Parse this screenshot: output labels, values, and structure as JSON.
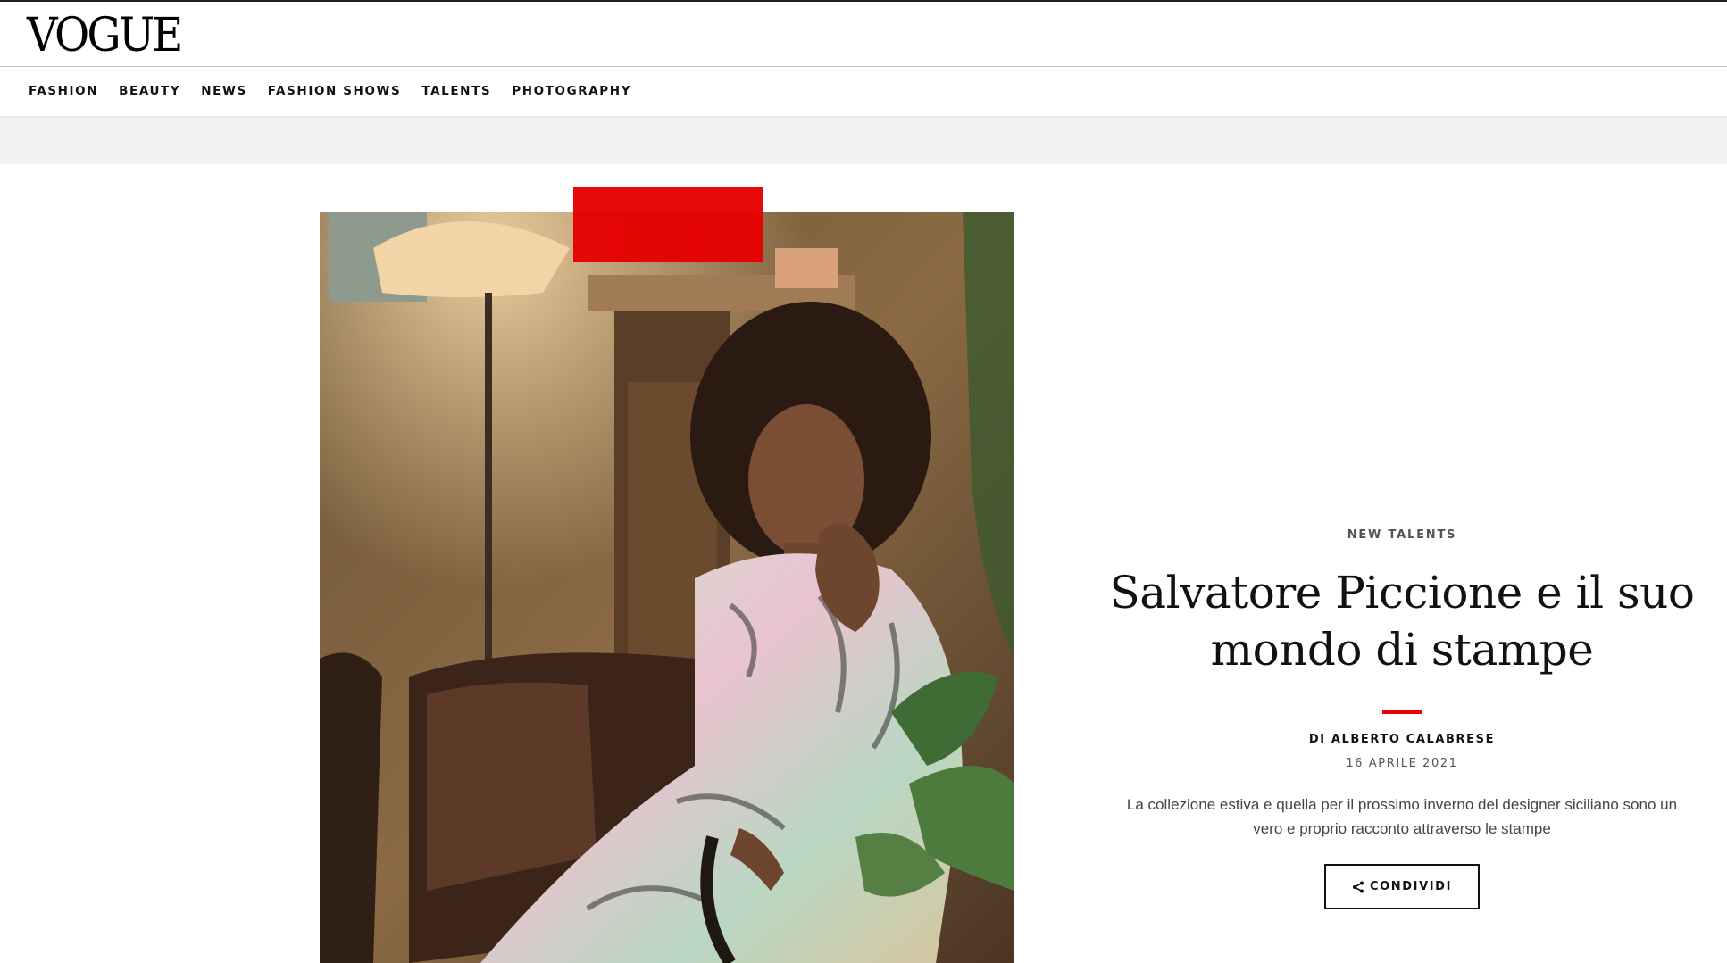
{
  "site": {
    "logo": "VOGUE"
  },
  "nav": {
    "items": [
      {
        "label": "FASHION"
      },
      {
        "label": "BEAUTY"
      },
      {
        "label": "NEWS"
      },
      {
        "label": "FASHION SHOWS"
      },
      {
        "label": "TALENTS"
      },
      {
        "label": "PHOTOGRAPHY"
      }
    ]
  },
  "article": {
    "rubric": "NEW TALENTS",
    "title": "Salvatore Piccione e il suo mondo di stampe",
    "byline_prefix": "DI",
    "author": "ALBERTO CALABRESE",
    "date": "16 APRILE 2021",
    "dek": "La collezione estiva e quella per il prossimo inverno del designer siciliano sono un vero e proprio racconto attraverso le stampe",
    "share_label": "CONDIVIDI",
    "share_icon": "share-icon"
  },
  "colors": {
    "accent": "#e60000",
    "text": "#111111",
    "muted": "#555555",
    "band": "#f1f1f1"
  }
}
